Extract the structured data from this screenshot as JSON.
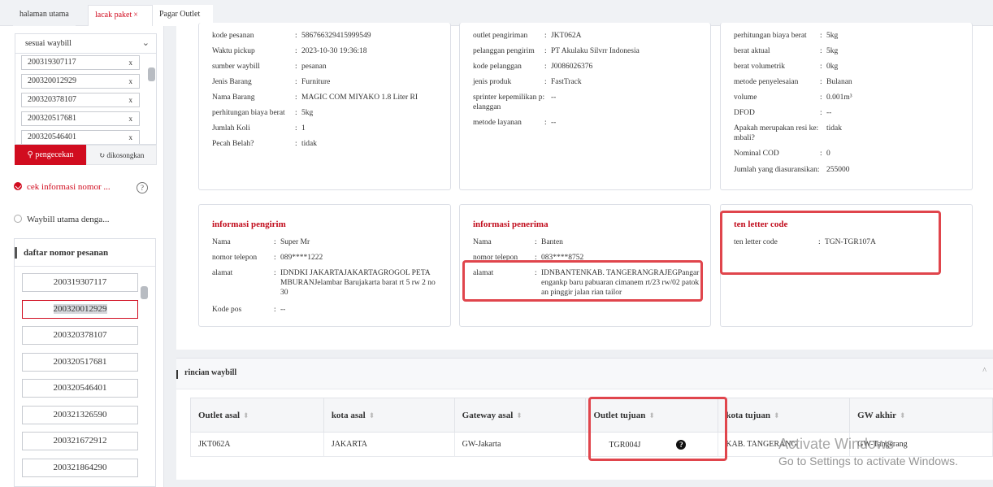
{
  "tabs": [
    {
      "label": "halaman utama"
    },
    {
      "label": "lacak paket",
      "close": "×"
    },
    {
      "label": "Pagar Outlet"
    }
  ],
  "sidebar": {
    "select_value": "sesuai waybill",
    "select_icon": "chevron-down-icon",
    "waybill_inputs": [
      "200319307117",
      "200320012929",
      "200320378107",
      "200320517681",
      "200320546401"
    ],
    "remove_glyph": "x",
    "check_button": "pengecekan",
    "check_icon": "search-icon",
    "clear_button": "dikosongkan",
    "clear_icon": "refresh-icon",
    "option_1": "cek informasi nomor ...",
    "option_2": "Waybill utama denga...",
    "help_glyph": "?",
    "order_list_title": "daftar nomor pesanan",
    "orders": [
      "200319307117",
      "200320012929",
      "200320378107",
      "200320517681",
      "200320546401",
      "200321326590",
      "200321672912",
      "200321864290"
    ],
    "selected_order": "200320012929"
  },
  "order_card": {
    "rows": [
      {
        "k": "kode pesanan",
        "v": "586766329415999549"
      },
      {
        "k": "Waktu pickup",
        "v": "2023-10-30 19:36:18"
      },
      {
        "k": "sumber waybill",
        "v": "pesanan"
      },
      {
        "k": "Jenis Barang",
        "v": "Furniture"
      },
      {
        "k": "Nama Barang",
        "v": "MAGIC COM MIYAKO 1.8 Liter RI"
      },
      {
        "k": "perhitungan biaya berat",
        "v": "5kg"
      },
      {
        "k": "Jumlah Koli",
        "v": "1"
      },
      {
        "k": "Pecah Belah?",
        "v": "tidak"
      }
    ]
  },
  "outlet_card": {
    "rows": [
      {
        "k": "outlet pengiriman",
        "v": "JKT062A"
      },
      {
        "k": "pelanggan pengirim",
        "v": "PT Akulaku Silvrr Indonesia"
      },
      {
        "k": "kode pelanggan",
        "v": "J0086026376"
      },
      {
        "k": "jenis produk",
        "v": "FastTrack"
      },
      {
        "k": "sprinter kepemilikan p: elanggan",
        "v": "--"
      },
      {
        "k": "metode layanan",
        "v": "--"
      }
    ]
  },
  "cost_card": {
    "rows": [
      {
        "k": "perhitungan biaya berat",
        "v": "5kg"
      },
      {
        "k": "berat aktual",
        "v": "5kg"
      },
      {
        "k": "berat volumetrik",
        "v": "0kg"
      },
      {
        "k": "metode penyelesaian",
        "v": "Bulanan"
      },
      {
        "k": "volume",
        "v": "0.001m³"
      },
      {
        "k": "DFOD",
        "v": "--"
      },
      {
        "k": "Apakah merupakan resi ke: mbali?",
        "v": "tidak"
      },
      {
        "k": "Nominal COD",
        "v": "0"
      },
      {
        "k": "Jumlah yang diasuransikan:",
        "v": "255000"
      }
    ]
  },
  "sender_card": {
    "title": "informasi pengirim",
    "rows": [
      {
        "k": "Nama",
        "v": "Super Mr"
      },
      {
        "k": "nomor telepon",
        "v": "089****1222"
      },
      {
        "k": "alamat",
        "v": "IDNDKI JAKARTAJAKARTAGROGOL PETAMBURANJelambar Barujakarta barat rt 5 rw 2 no 30"
      },
      {
        "k": "Kode pos",
        "v": "--"
      }
    ]
  },
  "receiver_card": {
    "title": "informasi penerima",
    "rows": [
      {
        "k": "Nama",
        "v": "Banten"
      },
      {
        "k": "nomor telepon",
        "v": "083****8752"
      },
      {
        "k": "alamat",
        "v": "IDNBANTENKAB. TANGERANGRAJEGPangarengankp baru pabuaran cimanem rt/23 rw/02 patokan pinggir jalan rian tailor"
      }
    ]
  },
  "tlc_card": {
    "title": "ten letter code",
    "rows": [
      {
        "k": "ten letter code",
        "v": "TGN-TGR107A"
      }
    ]
  },
  "rincian": {
    "title": "rincian waybill",
    "collapse_glyph": "^",
    "columns": [
      "Outlet asal",
      "kota asal",
      "Gateway asal",
      "Outlet tujuan",
      "kota tujuan",
      "GW akhir"
    ],
    "sort_glyph": "⬍",
    "row": [
      "JKT062A",
      "JAKARTA",
      "GW-Jakarta",
      "TGR004J",
      "KAB. TANGERANG",
      "GW-Tangerang"
    ],
    "info_glyph": "?"
  },
  "watermark": {
    "line1": "Activate Windows",
    "line2": "Go to Settings to activate Windows."
  },
  "colors": {
    "accent": "#d10c1f",
    "highlight_box": "#e0454c"
  }
}
